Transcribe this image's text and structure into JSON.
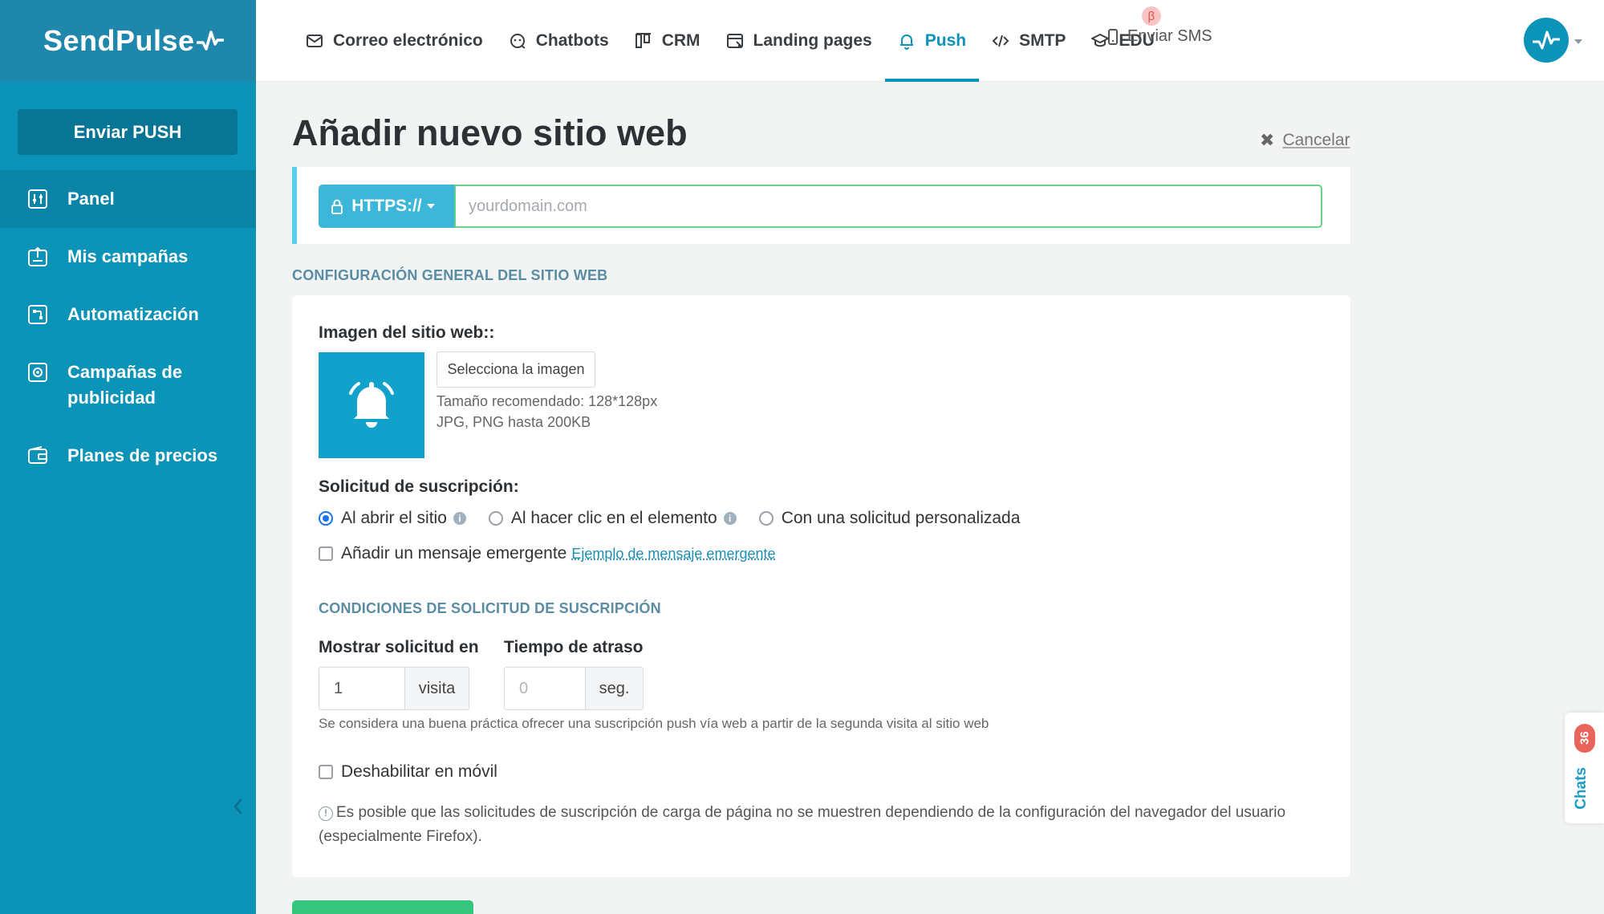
{
  "brand": {
    "name": "SendPulse"
  },
  "sidebar": {
    "send_button": "Enviar PUSH",
    "items": [
      {
        "label": "Panel",
        "icon": "dashboard-icon",
        "active": true
      },
      {
        "label": "Mis campañas",
        "icon": "campaigns-icon",
        "active": false
      },
      {
        "label": "Automatización",
        "icon": "automation-icon",
        "active": false
      },
      {
        "label": "Campañas de publicidad",
        "icon": "ads-icon",
        "active": false
      },
      {
        "label": "Planes de precios",
        "icon": "wallet-icon",
        "active": false
      }
    ]
  },
  "topnav": {
    "tabs": [
      {
        "label": "Correo electrónico",
        "icon": "email-icon"
      },
      {
        "label": "Chatbots",
        "icon": "chatbot-icon"
      },
      {
        "label": "CRM",
        "icon": "crm-icon"
      },
      {
        "label": "Landing pages",
        "icon": "landing-icon"
      },
      {
        "label": "Push",
        "icon": "bell-icon",
        "active": true
      },
      {
        "label": "SMTP",
        "icon": "code-icon"
      },
      {
        "label": "EDU",
        "icon": "graduation-cap-icon",
        "badge": "β"
      }
    ],
    "sms_label": "Enviar SMS"
  },
  "page": {
    "title": "Añadir nuevo sitio web",
    "cancel_label": "Cancelar"
  },
  "domain": {
    "protocol_label": "HTTPS://",
    "placeholder": "yourdomain.com",
    "value": ""
  },
  "general": {
    "heading": "CONFIGURACIÓN GENERAL DEL SITIO WEB",
    "image_label": "Imagen del sitio web::",
    "select_image_button": "Selecciona la imagen",
    "hint_size": "Tamaño recomendado: 128*128px",
    "hint_formats": "JPG, PNG hasta 200KB",
    "subscription_label": "Solicitud de suscripción:",
    "radio_options": [
      {
        "label": "Al abrir el sitio",
        "checked": true,
        "info": true
      },
      {
        "label": "Al hacer clic en el elemento",
        "checked": false,
        "info": true
      },
      {
        "label": "Con una solicitud personalizada",
        "checked": false,
        "info": false
      }
    ],
    "popup_checkbox_label": "Añadir un mensaje emergente",
    "popup_example_link": "Ejemplo de mensaje emergente"
  },
  "conditions": {
    "heading": "CONDICIONES DE SOLICITUD DE SUSCRIPCIÓN",
    "show_on_label": "Mostrar solicitud en",
    "show_on_value": "1",
    "show_on_unit": "visita",
    "delay_label": "Tiempo de atraso",
    "delay_placeholder": "0",
    "delay_unit": "seg.",
    "best_practice_hint": "Se considera una buena práctica ofrecer una suscripción push vía web a partir de la segunda visita al sitio web",
    "disable_mobile_label": "Deshabilitar en móvil",
    "warning_note": "Es posible que las solicitudes de suscripción de carga de página no se muestren dependiendo de la configuración del navegador del usuario (especialmente Firefox)."
  },
  "chats_widget": {
    "label": "Chats",
    "count": "36"
  },
  "colors": {
    "sidebar": "#0b93b8",
    "accent": "#0b93b8",
    "input_focus": "#63d38a",
    "save_button": "#35c57d",
    "badge": "#e9655b"
  }
}
